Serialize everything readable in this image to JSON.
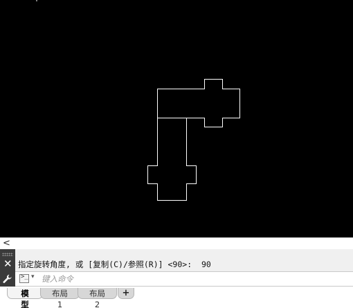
{
  "canvas": {
    "background": "#000000",
    "stroke_color": "#ffffff"
  },
  "scrollbar": {
    "left_arrow": "<"
  },
  "command_line": {
    "close_glyph": "✕",
    "history": "指定旋转角度, 或 [复制(C)/参照(R)] <90>:  90",
    "prompt_glyph": ">_",
    "prompt_caret": "▾",
    "input_value": "",
    "input_placeholder": "键入命令"
  },
  "tabs": [
    {
      "label": "模型",
      "active": true
    },
    {
      "label": "布局1",
      "active": false
    },
    {
      "label": "布局2",
      "active": false
    }
  ],
  "add_tab_label": "+"
}
